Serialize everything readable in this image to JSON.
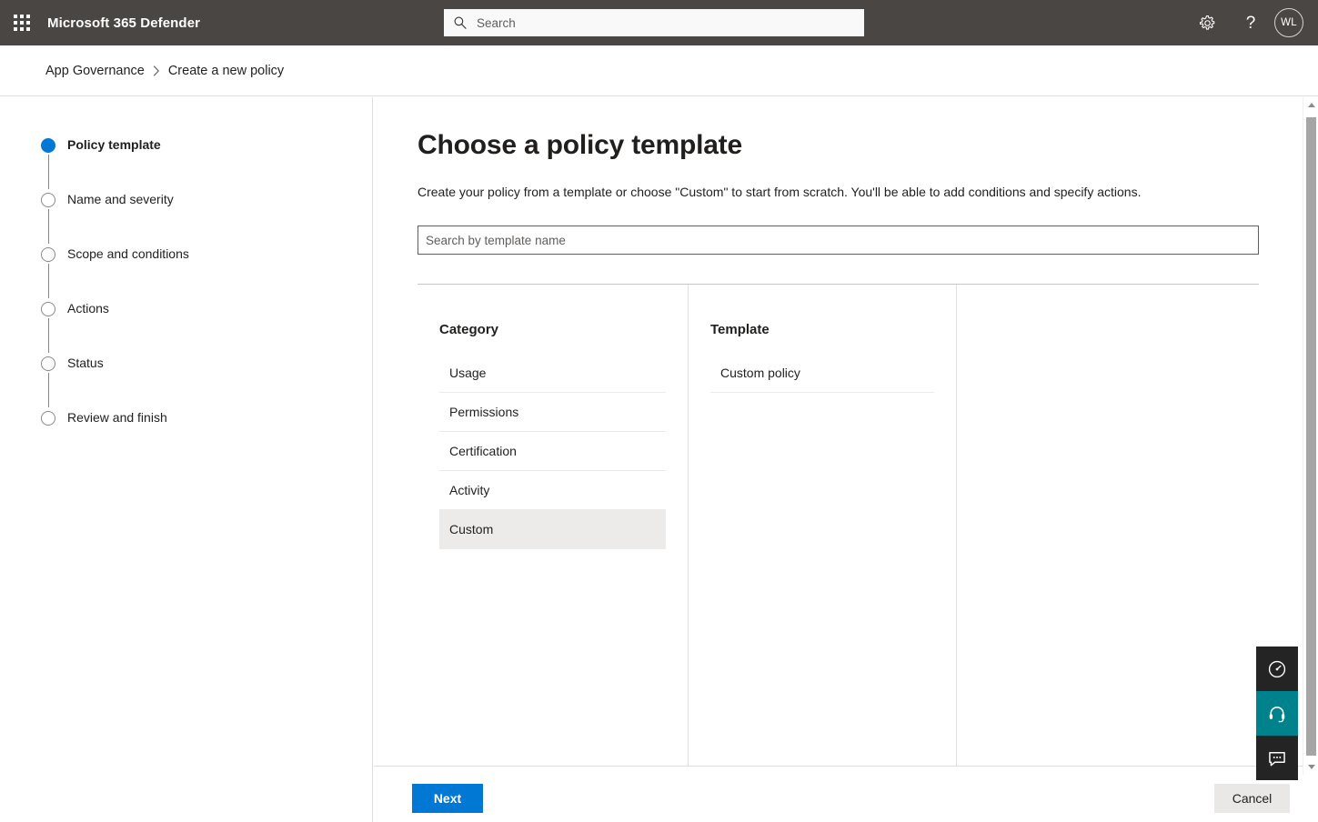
{
  "suite": {
    "waffle_label": "App launcher",
    "title": "Microsoft 365 Defender",
    "search_placeholder": "Search",
    "search_value": "",
    "help_glyph": "?",
    "avatar_initials": "WL"
  },
  "breadcrumb": {
    "root": "App Governance",
    "separator": "›",
    "current": "Create a new policy"
  },
  "wizard": {
    "steps": [
      {
        "label": "Policy template",
        "state": "active"
      },
      {
        "label": "Name and severity",
        "state": "pending"
      },
      {
        "label": "Scope and conditions",
        "state": "pending"
      },
      {
        "label": "Actions",
        "state": "pending"
      },
      {
        "label": "Status",
        "state": "pending"
      },
      {
        "label": "Review and finish",
        "state": "pending"
      }
    ]
  },
  "main": {
    "title": "Choose a policy template",
    "description": "Create your policy from a template or choose \"Custom\" to start from scratch. You'll be able to add conditions and specify actions.",
    "search_placeholder": "Search by template name",
    "search_value": "",
    "category": {
      "heading": "Category",
      "items": [
        {
          "label": "Usage",
          "selected": false
        },
        {
          "label": "Permissions",
          "selected": false
        },
        {
          "label": "Certification",
          "selected": false
        },
        {
          "label": "Activity",
          "selected": false
        },
        {
          "label": "Custom",
          "selected": true
        }
      ]
    },
    "template": {
      "heading": "Template",
      "items": [
        {
          "label": "Custom policy",
          "selected": false
        }
      ]
    },
    "detail": {
      "items": []
    }
  },
  "footer": {
    "next_label": "Next",
    "cancel_label": "Cancel"
  },
  "fab_rail": {
    "items": [
      {
        "name": "performance-gauge-icon",
        "style": "dark"
      },
      {
        "name": "support-headset-icon",
        "style": "teal"
      },
      {
        "name": "feedback-chat-icon",
        "style": "dark"
      }
    ]
  },
  "colors": {
    "suite_bar": "#4a4643",
    "accent": "#0078d4",
    "teal_fab": "#00828c",
    "dark_fab": "#242424",
    "selected_row": "#edebe9"
  }
}
